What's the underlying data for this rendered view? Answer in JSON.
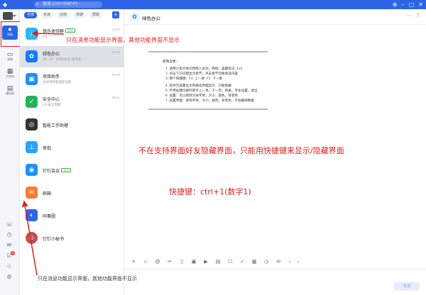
{
  "titlebar": {
    "logo_icon": "dingtalk-logo-icon",
    "search_placeholder": "搜索 (Ctrl+Shift+F)",
    "search_icon": "search-icon",
    "right_icons": [
      "add-icon",
      "minimize-icon",
      "maximize-icon",
      "close-icon"
    ],
    "accent_color": "#2d64e6"
  },
  "rail": {
    "items": [
      {
        "label": "消息",
        "icon": "message-icon",
        "active": true
      },
      {
        "label": "文档",
        "icon": "document-icon",
        "active": false
      },
      {
        "label": "工作台",
        "icon": "workbench-icon",
        "active": false
      },
      {
        "label": "通讯录",
        "icon": "contacts-icon",
        "active": false
      }
    ],
    "bottom_icons": [
      "phone-icon",
      "calendar-icon",
      "mail-icon",
      "todo-icon",
      "star-icon",
      "settings-icon"
    ],
    "todo_badge": "2"
  },
  "convlist": {
    "tabs": [
      "全部",
      "未读",
      "@我",
      "单聊",
      "群聊"
    ],
    "add_icon": "add-icon",
    "items": [
      {
        "name": "快乐体验群",
        "preview": "0.0",
        "time": "13:47",
        "tag": "官方",
        "color": "#2db7f5",
        "icon": "group-icon"
      },
      {
        "name": "绿色办公",
        "preview": "[有一份 · [绿色协作] 待审批 ...",
        "time": "08:25",
        "tag": "",
        "color": "#1677ff",
        "icon": "office-icon"
      },
      {
        "name": "项目助手",
        "preview": "试试项目管理新功能",
        "time": "08:10",
        "tag": "",
        "color": "#1f8fff",
        "icon": "project-icon"
      },
      {
        "name": "安全中心",
        "preview": "LTL安全提醒",
        "time": "08:11",
        "tag": "",
        "color": "#21b45e",
        "icon": "shield-icon"
      },
      {
        "name": "智能工作助理",
        "preview": "",
        "time": "",
        "tag": "",
        "color": "#333333",
        "icon": "robot-icon"
      },
      {
        "name": "审批",
        "preview": "",
        "time": "",
        "tag": "",
        "color": "#2ba1ff",
        "icon": "approval-icon"
      },
      {
        "name": "钉钉会议",
        "preview": "",
        "time": "",
        "tag": "官方",
        "color": "#1f8fff",
        "icon": "meeting-icon"
      },
      {
        "name": "邮箱",
        "preview": "",
        "time": "",
        "tag": "",
        "color": "#ff7a2e",
        "icon": "mail-icon"
      },
      {
        "name": "同事圈",
        "preview": "",
        "time": "",
        "tag": "",
        "color": "#2d64e6",
        "icon": "moments-icon"
      },
      {
        "name": "钉钉小秘书",
        "preview": "",
        "time": "",
        "tag": "",
        "color": "#c05050",
        "icon": "assistant-avatar"
      }
    ]
  },
  "chat": {
    "title": "绿色办公",
    "header_icons": [
      "more-icon",
      "pin-icon"
    ],
    "doc": {
      "dashes": "==========================================================================",
      "heading": "使用说明：",
      "lines": [
        "1.调用小说文本文档拖入此次，例如：盗墓笔记.txt",
        "2.点击下方切题显示章节，点击章节切换阅读内容",
        "3.两个快捷键：F1 上一章    F2 下一章",
        "4.软件可设置位文件路径界面显示，只能隐藏",
        "5.不用右键切换时即可上一页，下一页，目录，字体设置，退出",
        "6.设置：可以更改文本字体，大小，颜色，背景色",
        "7.设置界面：保存字体，大小，颜色，背景色，不会删除数据"
      ]
    }
  },
  "annotations": {
    "top": "只在消息功能显示界面，其他功能界面不显示",
    "middle": "不在支持界面好友隐藏界面，只能用快捷键来显示/隐藏界面",
    "hotkey": "快捷键：ctrl+1(数字1)",
    "bottom": "只在消息功能显示界面，其他功能界面不显示",
    "color": "#e02020"
  },
  "input_toolbar": {
    "icons": [
      "format-icon",
      "emoji-icon",
      "at-icon",
      "cut-icon",
      "file-icon",
      "image-icon",
      "video-icon",
      "doc-icon",
      "todo-icon",
      "check-icon",
      "calendar-icon",
      "history-icon",
      "mail-icon",
      "prev-icon",
      "next-icon"
    ],
    "send_label": "发送"
  }
}
